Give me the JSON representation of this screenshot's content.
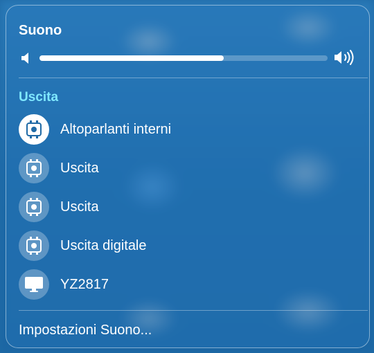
{
  "sound": {
    "title": "Suono",
    "volume_percent": 64,
    "low_icon": "speaker-low-icon",
    "high_icon": "speaker-high-icon"
  },
  "output": {
    "title": "Uscita",
    "devices": [
      {
        "label": "Altoparlanti interni",
        "icon": "speaker-device-icon",
        "selected": true
      },
      {
        "label": "Uscita",
        "icon": "speaker-device-icon",
        "selected": false
      },
      {
        "label": "Uscita",
        "icon": "speaker-device-icon",
        "selected": false
      },
      {
        "label": "Uscita digitale",
        "icon": "speaker-device-icon",
        "selected": false
      },
      {
        "label": "YZ2817",
        "icon": "display-icon",
        "selected": false
      }
    ]
  },
  "footer": {
    "settings_label": "Impostazioni Suono..."
  },
  "colors": {
    "accent_title": "#7fe8ff",
    "selected_icon_bg": "#ffffff",
    "selected_icon_fg": "#1f6aa6"
  }
}
